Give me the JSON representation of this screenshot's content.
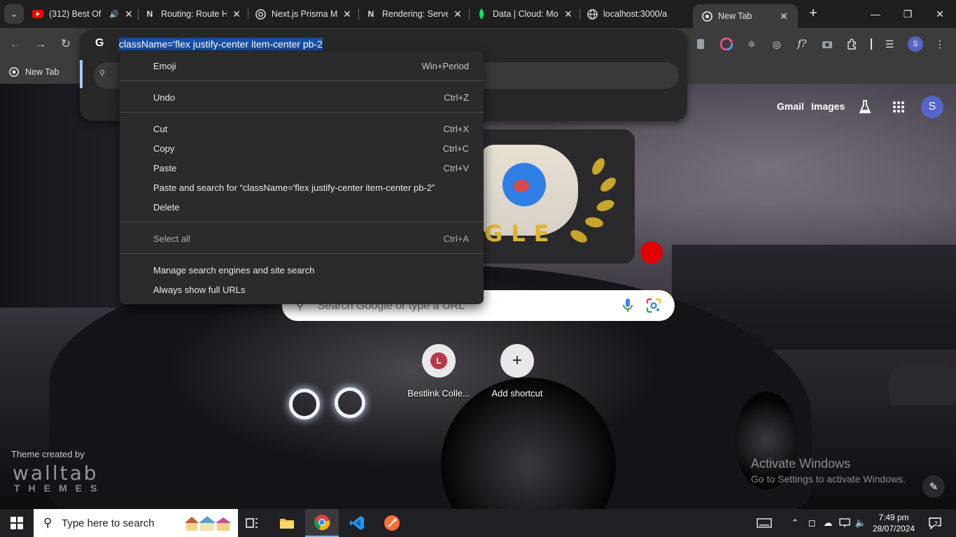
{
  "tabs": [
    {
      "title": "(312) Best Of",
      "icon": "youtube-icon",
      "audio": true
    },
    {
      "title": "Routing: Route H",
      "icon": "nextjs-icon"
    },
    {
      "title": "Next.js Prisma M",
      "icon": "chatgpt-icon"
    },
    {
      "title": "Rendering: Serve",
      "icon": "nextjs-icon"
    },
    {
      "title": "Data | Cloud: Mo",
      "icon": "mongodb-icon"
    },
    {
      "title": "localhost:3000/a",
      "icon": "globe-icon"
    },
    {
      "title": "New Tab",
      "icon": "chrome-icon",
      "active": true
    }
  ],
  "omnibox": {
    "text": "className='flex justify-center item-center pb-2"
  },
  "bookmarks": [
    {
      "label": "New Tab"
    }
  ],
  "context_menu": {
    "items": [
      {
        "label": "Emoji",
        "shortcut": "Win+Period"
      },
      {
        "label": "Undo",
        "shortcut": "Ctrl+Z"
      },
      {
        "label": "Cut",
        "shortcut": "Ctrl+X"
      },
      {
        "label": "Copy",
        "shortcut": "Ctrl+C"
      },
      {
        "label": "Paste",
        "shortcut": "Ctrl+V"
      },
      {
        "label": "Paste and search for “className='flex justify-center item-center pb-2”",
        "shortcut": ""
      },
      {
        "label": "Delete",
        "shortcut": ""
      },
      {
        "label": "Select all",
        "shortcut": "Ctrl+A"
      },
      {
        "label": "Manage search engines and site search",
        "shortcut": ""
      },
      {
        "label": "Always show full URLs",
        "shortcut": ""
      }
    ]
  },
  "ntp": {
    "gmail": "Gmail",
    "images": "Images",
    "avatar_letter": "S",
    "doodle_text": "GLE",
    "search_placeholder": "Search Google or type a URL",
    "shortcuts": [
      {
        "label": "Bestlink Colle...",
        "letter": "L"
      },
      {
        "label": "Add shortcut",
        "letter": "+"
      }
    ],
    "theme_credit": "Theme created by",
    "theme_brand": "walltab",
    "theme_brand_sub": "THEMES",
    "activate_title": "Activate Windows",
    "activate_sub": "Go to Settings to activate Windows."
  },
  "taskbar": {
    "search_placeholder": "Type here to search",
    "time": "7:49 pm",
    "date": "28/07/2024",
    "notifications": "2"
  },
  "profile_letter": "S",
  "colors": {
    "selection": "#174ea6",
    "accent": "#a8c7fa",
    "avatar": "#5565c8"
  }
}
